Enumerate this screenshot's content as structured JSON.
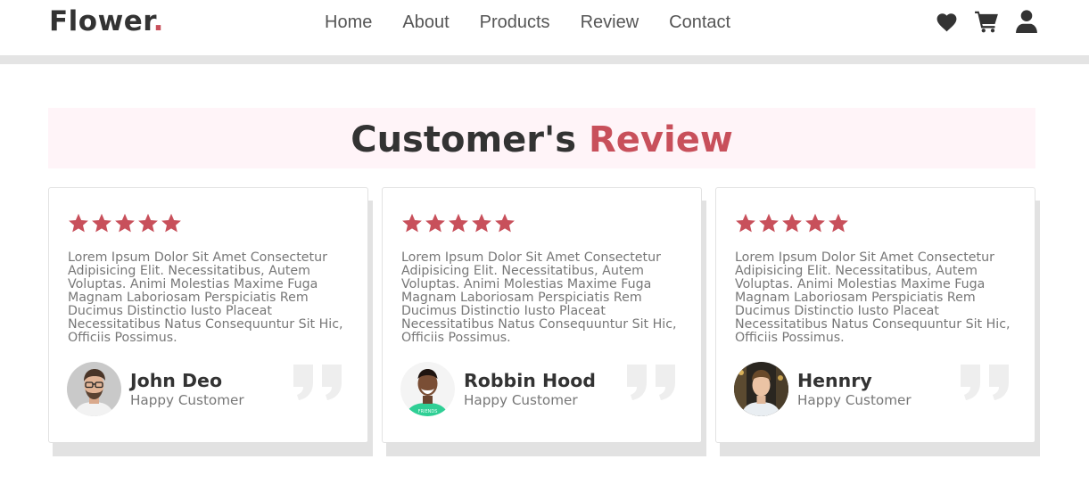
{
  "header": {
    "logo": {
      "text": "Flower",
      "dot": "."
    },
    "nav": [
      "Home",
      "About",
      "Products",
      "Review",
      "Contact"
    ],
    "icons": [
      "heart-icon",
      "cart-icon",
      "user-icon"
    ]
  },
  "section": {
    "title_main": "Customer's ",
    "title_accent": "Review"
  },
  "reviews": [
    {
      "rating": 5,
      "text": "Lorem Ipsum Dolor Sit Amet Consectetur Adipisicing Elit. Necessitatibus, Autem Voluptas. Animi Molestias Maxime Fuga Magnam Laboriosam Perspiciatis Rem Ducimus Distinctio Iusto Placeat Necessitatibus Natus Consequuntur Sit Hic, Officiis Possimus.",
      "name": "John Deo",
      "role": "Happy Customer"
    },
    {
      "rating": 5,
      "text": "Lorem Ipsum Dolor Sit Amet Consectetur Adipisicing Elit. Necessitatibus, Autem Voluptas. Animi Molestias Maxime Fuga Magnam Laboriosam Perspiciatis Rem Ducimus Distinctio Iusto Placeat Necessitatibus Natus Consequuntur Sit Hic, Officiis Possimus.",
      "name": "Robbin Hood",
      "role": "Happy Customer"
    },
    {
      "rating": 5,
      "text": "Lorem Ipsum Dolor Sit Amet Consectetur Adipisicing Elit. Necessitatibus, Autem Voluptas. Animi Molestias Maxime Fuga Magnam Laboriosam Perspiciatis Rem Ducimus Distinctio Iusto Placeat Necessitatibus Natus Consequuntur Sit Hic, Officiis Possimus.",
      "name": "Hennry",
      "role": "Happy Customer"
    }
  ],
  "colors": {
    "accent": "#c8505b",
    "text": "#333333",
    "muted": "#777777",
    "band": "#fff4f8",
    "quote": "#eeeeee"
  }
}
